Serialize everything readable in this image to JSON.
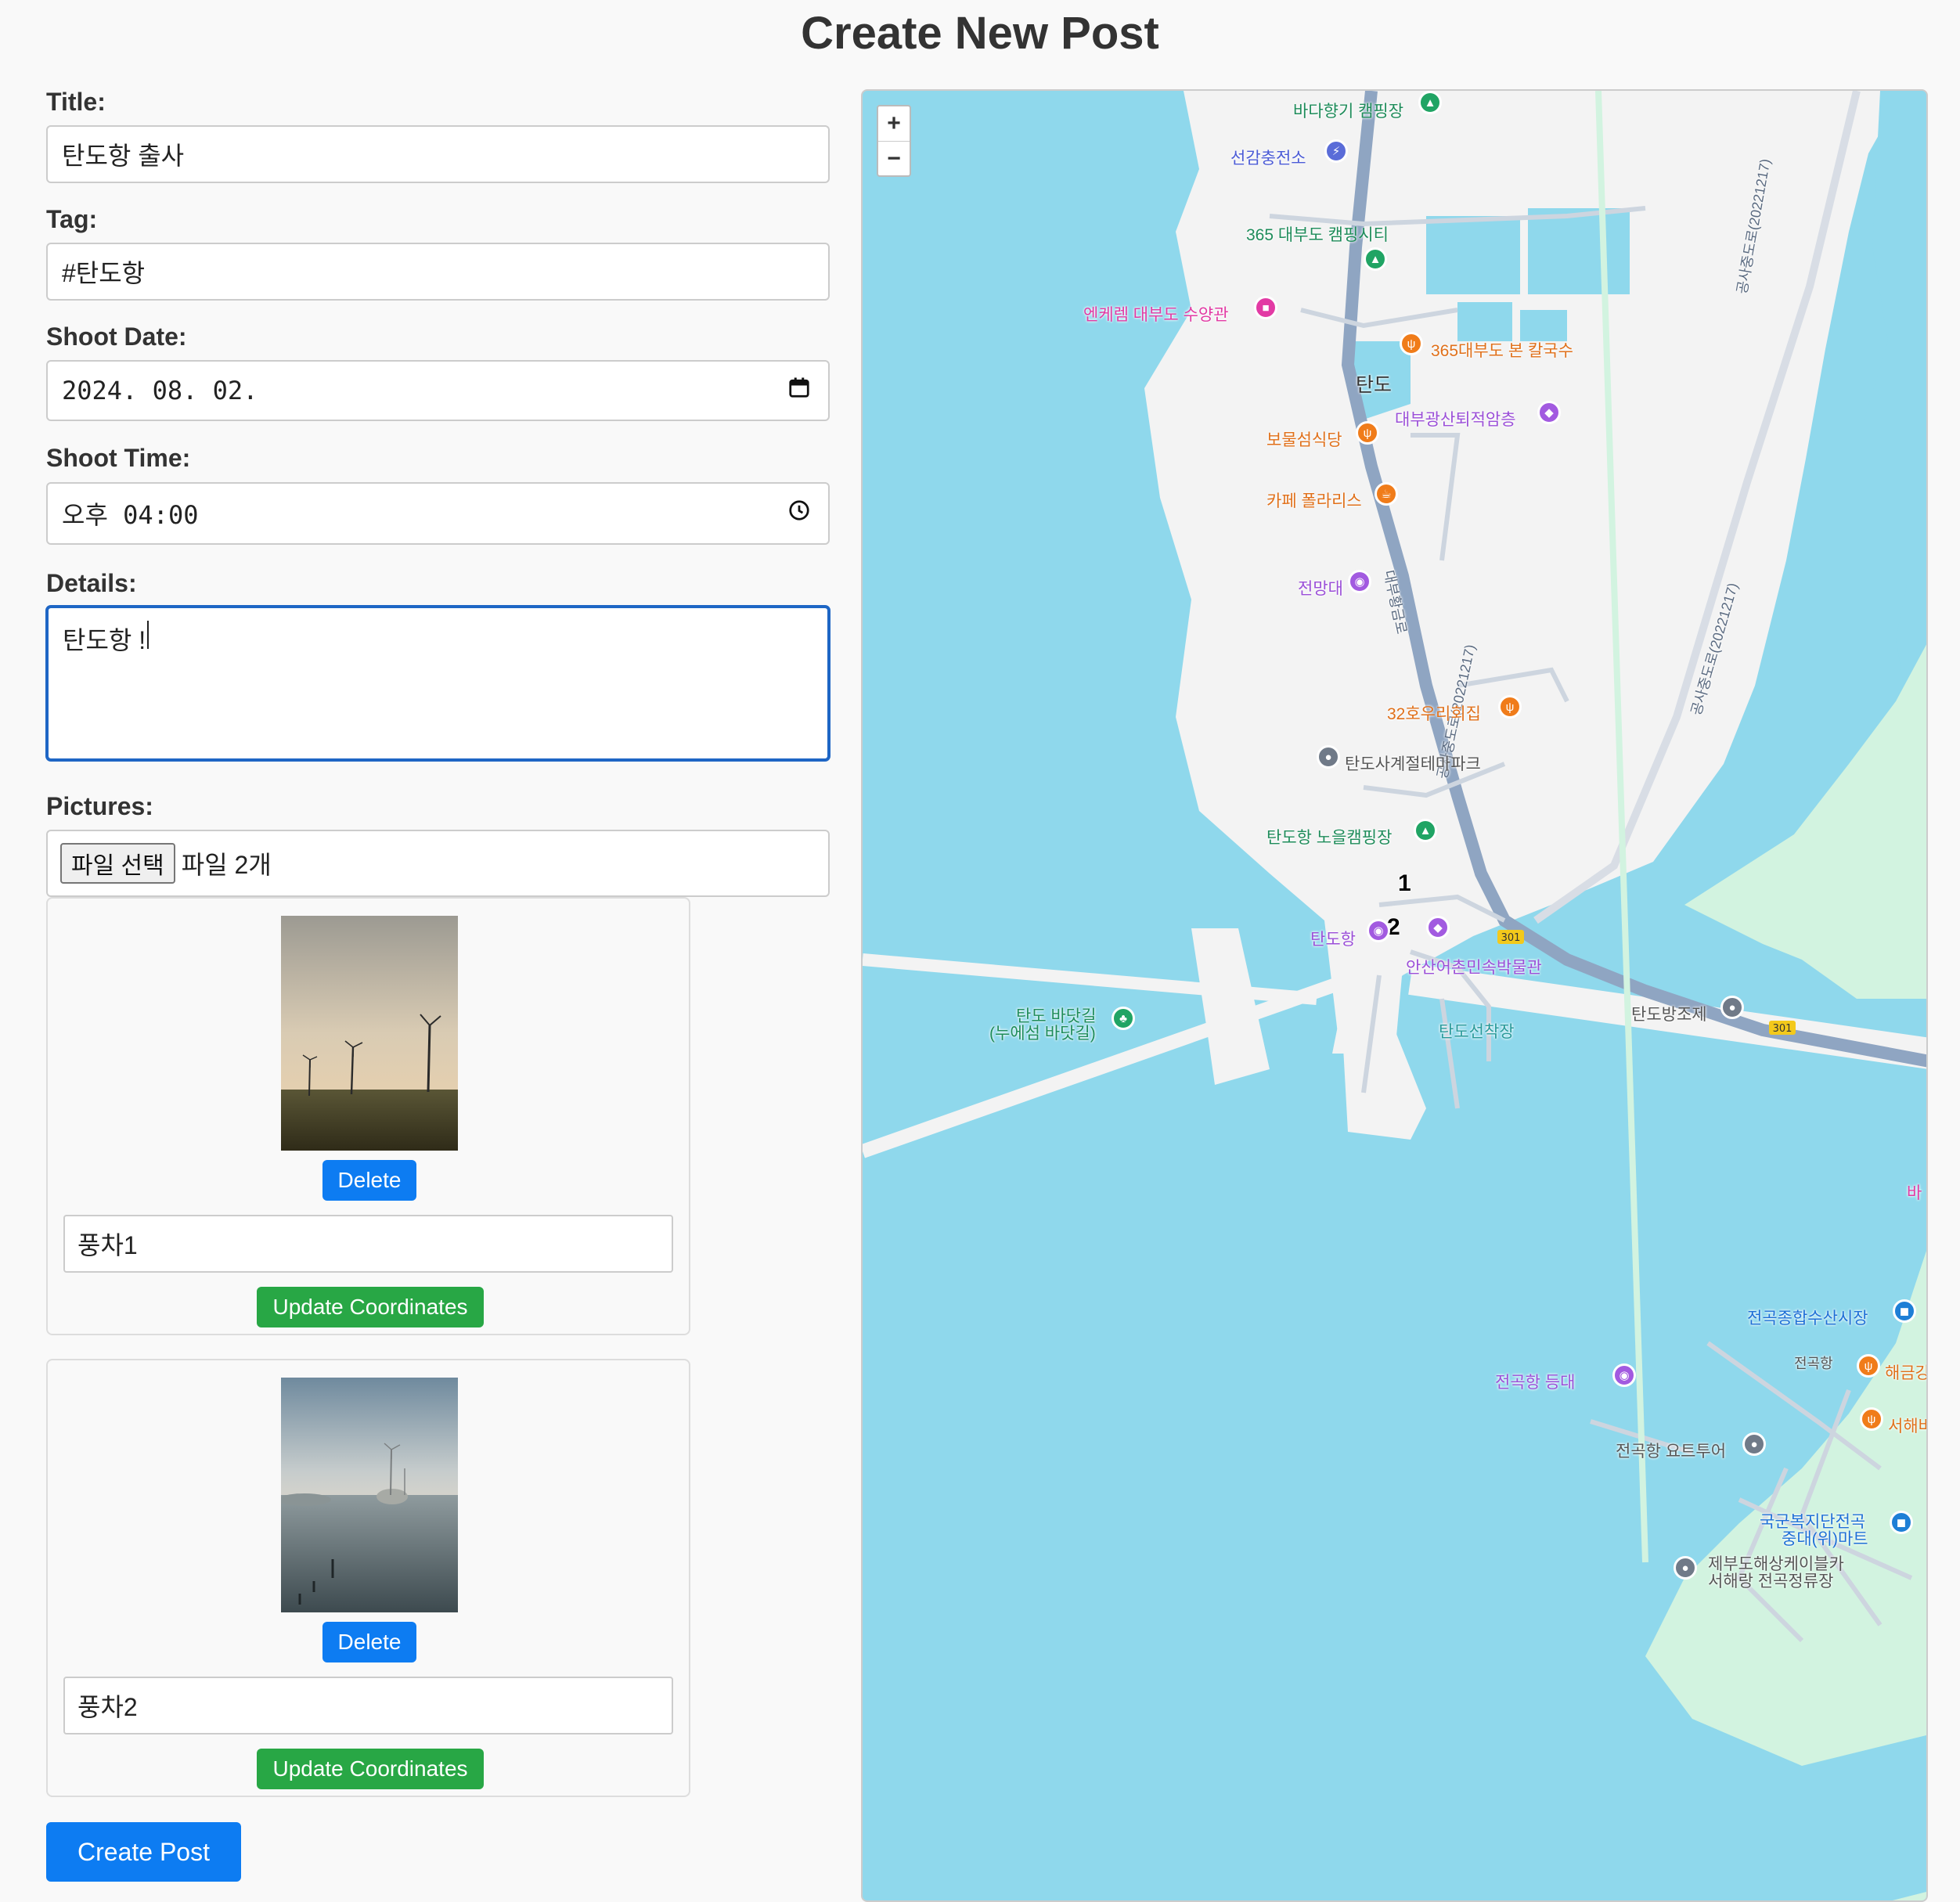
{
  "page": {
    "title": "Create New Post"
  },
  "form": {
    "title_label": "Title:",
    "title_value": "탄도항 출사",
    "tag_label": "Tag:",
    "tag_value": "#탄도항",
    "date_label": "Shoot Date:",
    "date_value": "2024. 08. 02.",
    "time_label": "Shoot Time:",
    "time_value": "오후 04:00",
    "details_label": "Details:",
    "details_value": "탄도항 !",
    "pictures_label": "Pictures:",
    "file_button": "파일 선택",
    "file_status": "파일 2개",
    "create_button": "Create Post"
  },
  "pictures": [
    {
      "caption": "풍차1",
      "delete_label": "Delete",
      "update_label": "Update Coordinates"
    },
    {
      "caption": "풍차2",
      "delete_label": "Delete",
      "update_label": "Update Coordinates"
    }
  ],
  "map": {
    "zoom_in": "+",
    "zoom_out": "−",
    "markers": [
      "1",
      "2"
    ],
    "labels": {
      "camp1": "바다향기 캠핑장",
      "charge": "선감충전소",
      "camp2": "365 대부도 캠핑시티",
      "resort": "엔케렘 대부도 수양관",
      "kal": "365대부도 본 칼국수",
      "tando": "탄도",
      "museum1": "대부광산퇴적암층",
      "bomul": "보물섬식당",
      "cafe": "카페 폴라리스",
      "view": "전망대",
      "road1": "대부황금로",
      "road2": "공사중도로(20221217)",
      "fish": "32호우리회집",
      "theme": "탄도사계절테마파크",
      "camp3": "탄도항 노을캠핑장",
      "tandohang": "탄도항",
      "museum2": "안산어촌민속박물관",
      "walk1": "탄도 바닷길",
      "walk2": "(누에섬 바닷길)",
      "dock": "탄도선착장",
      "dam": "탄도방조제",
      "market": "전곡종합수산시장",
      "lighthouse": "전곡항 등대",
      "jeongok": "전곡항",
      "haegeum": "해금강",
      "seohae": "서해바",
      "yacht": "전곡항 요트투어",
      "mart1": "국군복지단전곡",
      "mart2": "중대(위)마트",
      "cable1": "제부도해상케이블카",
      "cable2": "서해랑 전곡정류장",
      "route": "301",
      "edge": "바"
    }
  },
  "colors": {
    "primary": "#0d7cf2",
    "success": "#28a745",
    "sea": "#8fd8ec",
    "land": "#f4f4f4",
    "park": "#d2f3e0"
  }
}
